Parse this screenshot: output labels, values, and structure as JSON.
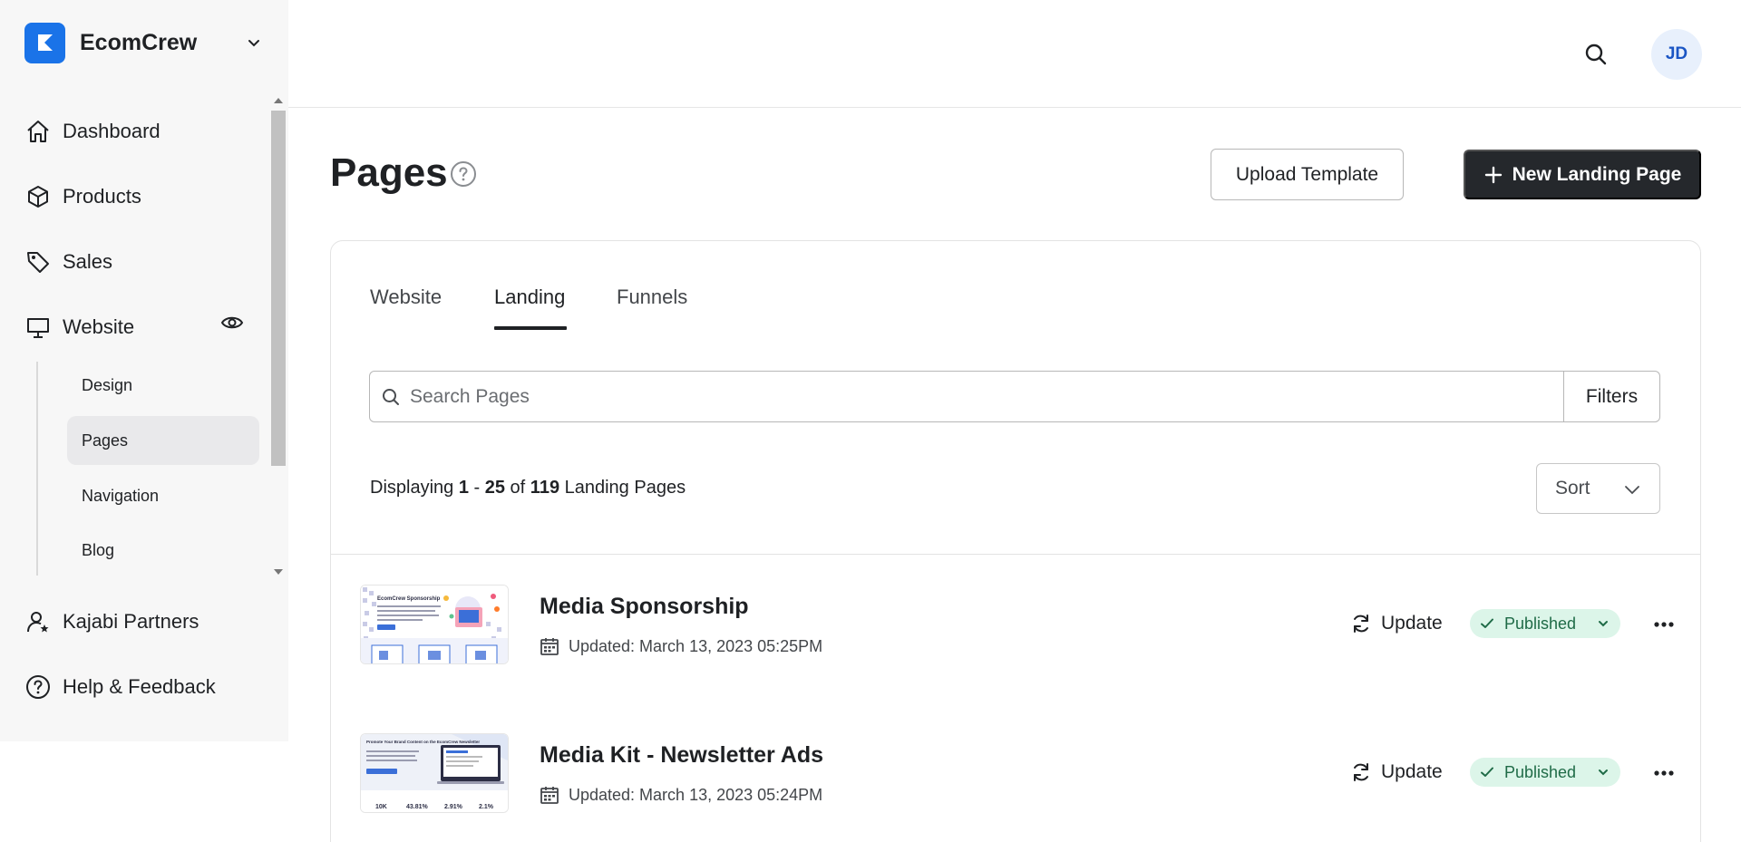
{
  "brand": {
    "name": "EcomCrew"
  },
  "nav": {
    "dashboard": "Dashboard",
    "products": "Products",
    "sales": "Sales",
    "website": "Website",
    "sub": [
      "Design",
      "Pages",
      "Navigation",
      "Blog"
    ],
    "partners": "Kajabi Partners",
    "help": "Help & Feedback"
  },
  "header": {
    "avatar_initials": "JD"
  },
  "page": {
    "title": "Pages",
    "upload_label": "Upload Template",
    "new_label": "New Landing Page"
  },
  "tabs": [
    "Website",
    "Landing",
    "Funnels"
  ],
  "search": {
    "placeholder": "Search Pages",
    "filters_label": "Filters"
  },
  "display": {
    "prefix": "Displaying",
    "range_start": "1",
    "range_end": "25",
    "of": "of",
    "total": "119",
    "suffix": "Landing Pages"
  },
  "sort": {
    "label": "Sort"
  },
  "rows": [
    {
      "title": "Media Sponsorship",
      "updated": "Updated: March 13, 2023 05:25PM",
      "update_label": "Update",
      "status": "Published"
    },
    {
      "title": "Media Kit - Newsletter Ads",
      "updated": "Updated: March 13, 2023 05:24PM",
      "update_label": "Update",
      "status": "Published"
    }
  ],
  "thumbs": {
    "first_heading": "EcomCrew Sponsorship",
    "second_heading": "Promote Your Brand Content on the EcomCrew Newsletter",
    "second_stats": [
      "10K",
      "43.81%",
      "2.91%",
      "2.1%"
    ]
  },
  "colors": {
    "brand_blue": "#1a73e8",
    "dark_button": "#25282c",
    "published_bg": "#dcf5e9",
    "published_text": "#1f6b47"
  }
}
